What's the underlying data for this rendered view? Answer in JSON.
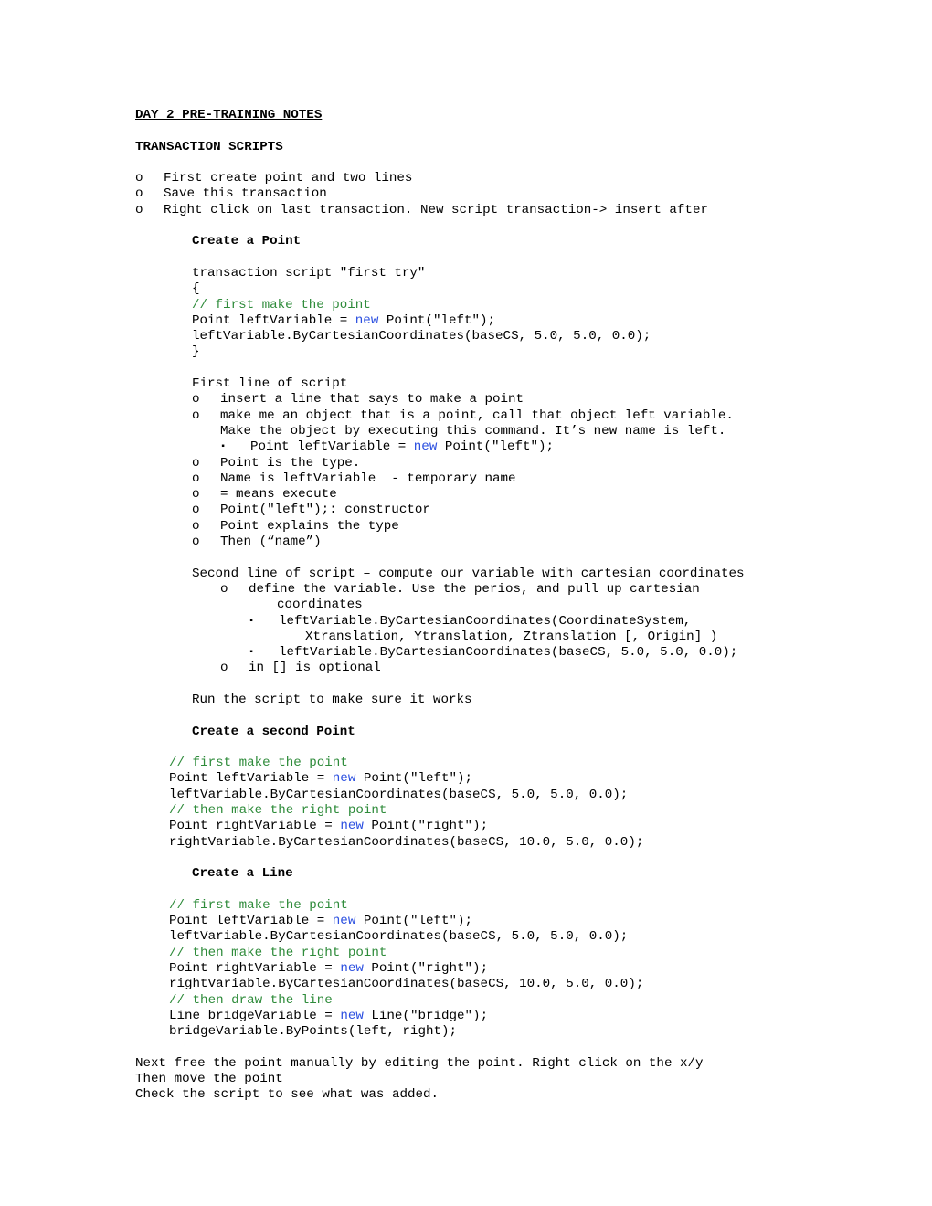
{
  "document": {
    "title": "DAY 2 PRE-TRAINING NOTES",
    "section_heading": "TRANSACTION SCRIPTS",
    "intro_bullets": [
      {
        "marker": "o",
        "text": "First create point and two lines"
      },
      {
        "marker": "o",
        "text": "Save this transaction"
      },
      {
        "marker": "o",
        "text": "Right click on last transaction. New script transaction-> insert after"
      }
    ],
    "create_point": {
      "heading": "Create a Point",
      "code": {
        "line1": "transaction script \"first try\"",
        "line2": "{",
        "line3_comment": "// first make the point",
        "line4_a": "Point leftVariable = ",
        "line4_kw": "new",
        "line4_b": " Point(\"left\");",
        "line5": "leftVariable.ByCartesianCoordinates(baseCS, 5.0, 5.0, 0.0);",
        "line6": "}"
      },
      "first_line": {
        "title": "First line of script",
        "bullets": [
          {
            "marker": "o",
            "text": "insert a line that says to make a point"
          },
          {
            "marker": "o",
            "text": "make me an object that is a point, call that object left variable."
          },
          {
            "marker": "o",
            "text": "Point is the type."
          },
          {
            "marker": "o",
            "text": "Name is leftVariable  - temporary name"
          },
          {
            "marker": "o",
            "text": "= means execute"
          },
          {
            "marker": "o",
            "text": "Point(\"left\");: constructor"
          },
          {
            "marker": "o",
            "text": "Point explains the type"
          },
          {
            "marker": "o",
            "text": "Then (“name”)"
          }
        ],
        "continuation": "Make the object by executing this command. It’s new name is left.",
        "sub_bullet": {
          "marker": "▪",
          "pre": "Point leftVariable = ",
          "kw": "new",
          "post": " Point(\"left\");"
        }
      },
      "second_line": {
        "title": "Second line of script – compute our variable with cartesian coordinates",
        "define_bullet": {
          "marker": "o",
          "text": "define the variable. Use the perios, and pull up cartesian"
        },
        "define_cont": "coordinates",
        "sub_bullets": [
          {
            "marker": "▪",
            "text": "leftVariable.ByCartesianCoordinates(CoordinateSystem,"
          },
          {
            "marker": "▪",
            "text": "leftVariable.ByCartesianCoordinates(baseCS, 5.0, 5.0, 0.0);"
          }
        ],
        "sub_cont": "Xtranslation, Ytranslation, Ztranslation [, Origin] )",
        "optional_bullet": {
          "marker": "o",
          "text": "in [] is optional"
        }
      },
      "run_note": "Run the script to make sure it works"
    },
    "create_second_point": {
      "heading": "Create a second Point",
      "code": {
        "c1": "// first make the point",
        "l2_a": "Point leftVariable = ",
        "l2_kw": "new",
        "l2_b": " Point(\"left\");",
        "l3": "leftVariable.ByCartesianCoordinates(baseCS, 5.0, 5.0, 0.0);",
        "c2": "// then make the right point",
        "l5_a": "Point rightVariable = ",
        "l5_kw": "new",
        "l5_b": " Point(\"right\");",
        "l6": "rightVariable.ByCartesianCoordinates(baseCS, 10.0, 5.0, 0.0);"
      }
    },
    "create_line": {
      "heading": "Create a Line",
      "code": {
        "c1": "// first make the point",
        "l2_a": "Point leftVariable = ",
        "l2_kw": "new",
        "l2_b": " Point(\"left\");",
        "l3": "leftVariable.ByCartesianCoordinates(baseCS, 5.0, 5.0, 0.0);",
        "c2": "// then make the right point",
        "l5_a": "Point rightVariable = ",
        "l5_kw": "new",
        "l5_b": " Point(\"right\");",
        "l6": "rightVariable.ByCartesianCoordinates(baseCS, 10.0, 5.0, 0.0);",
        "c3": "// then draw the line",
        "l8_a": "Line bridgeVariable = ",
        "l8_kw": "new",
        "l8_b": " Line(\"bridge\");",
        "l9": "bridgeVariable.ByPoints(left, right);"
      }
    },
    "closing": [
      "Next free the point manually by editing the point. Right click on the x/y",
      "Then move the point",
      "Check the script to see what was added."
    ]
  },
  "colors": {
    "comment": "#2e8b3a",
    "keyword": "#2b4fe0",
    "text": "#000000",
    "background": "#ffffff"
  }
}
